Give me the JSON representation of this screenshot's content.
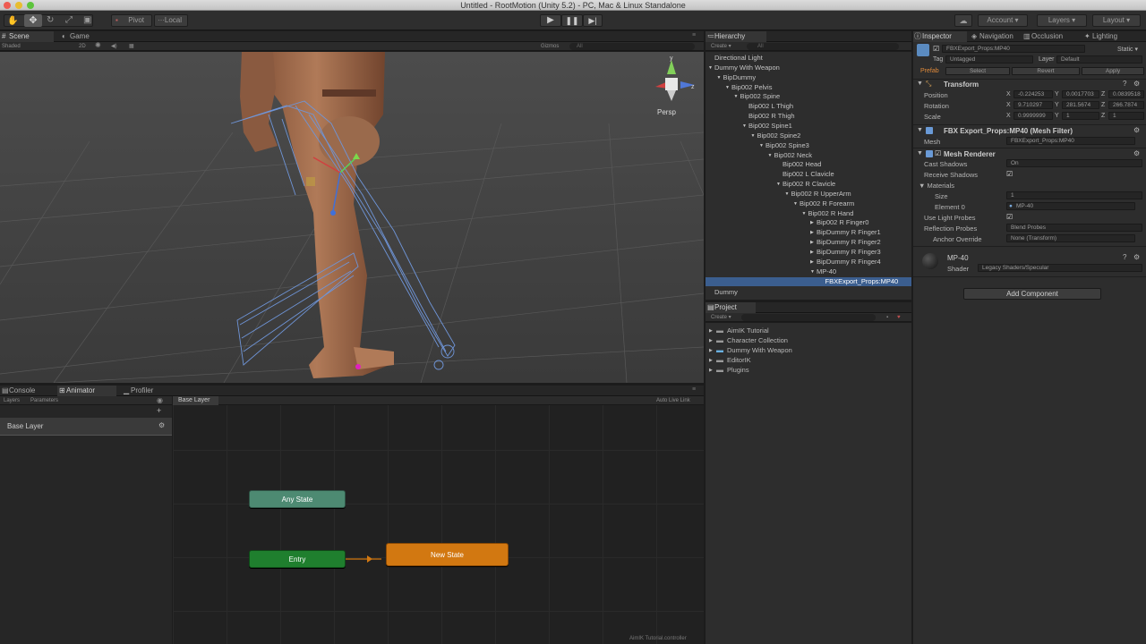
{
  "window": {
    "title": "Untitled - RootMotion (Unity 5.2) - PC, Mac & Linux Standalone"
  },
  "toolbar": {
    "pivot": "Pivot",
    "local": "Local",
    "account": "Account",
    "layers": "Layers",
    "layout": "Layout"
  },
  "scene": {
    "tabs": [
      "Scene",
      "Game"
    ],
    "shading": "Shaded",
    "mode_2d": "2D",
    "gizmos": "Gizmos",
    "search_placeholder": "All",
    "persp": "Persp"
  },
  "hierarchy": {
    "tab": "Hierarchy",
    "create": "Create",
    "search_placeholder": "All",
    "items": [
      {
        "label": "Directional Light",
        "depth": 0
      },
      {
        "label": "Dummy With Weapon",
        "depth": 0
      },
      {
        "label": "BipDummy",
        "depth": 1
      },
      {
        "label": "Bip002 Pelvis",
        "depth": 2
      },
      {
        "label": "Bip002 Spine",
        "depth": 3
      },
      {
        "label": "Bip002 L Thigh",
        "depth": 4
      },
      {
        "label": "Bip002 R Thigh",
        "depth": 4
      },
      {
        "label": "Bip002 Spine1",
        "depth": 4
      },
      {
        "label": "Bip002 Spine2",
        "depth": 5
      },
      {
        "label": "Bip002 Spine3",
        "depth": 6
      },
      {
        "label": "Bip002 Neck",
        "depth": 7
      },
      {
        "label": "Bip002 Head",
        "depth": 8
      },
      {
        "label": "Bip002 L Clavicle",
        "depth": 8
      },
      {
        "label": "Bip002 R Clavicle",
        "depth": 8
      },
      {
        "label": "Bip002 R UpperArm",
        "depth": 9
      },
      {
        "label": "Bip002 R Forearm",
        "depth": 10
      },
      {
        "label": "Bip002 R Hand",
        "depth": 11
      },
      {
        "label": "Bip002 R Finger0",
        "depth": 12
      },
      {
        "label": "BipDummy R Finger1",
        "depth": 12
      },
      {
        "label": "BipDummy R Finger2",
        "depth": 12
      },
      {
        "label": "BipDummy R Finger3",
        "depth": 12
      },
      {
        "label": "BipDummy R Finger4",
        "depth": 12
      },
      {
        "label": "MP-40",
        "depth": 12
      },
      {
        "label": "FBXExport_Props:MP40",
        "depth": 13,
        "selected": true
      },
      {
        "label": "Dummy",
        "depth": 0
      }
    ]
  },
  "project": {
    "tab": "Project",
    "create": "Create",
    "items": [
      "AimIK Tutorial",
      "Character Collection",
      "Dummy With Weapon",
      "EditorIK",
      "Plugins"
    ]
  },
  "inspector": {
    "tabs": [
      "Inspector",
      "Navigation",
      "Occlusion",
      "Lighting"
    ],
    "object_name": "FBXExport_Props:MP40",
    "static_label": "Static",
    "tag_label": "Tag",
    "tag_value": "Untagged",
    "layer_label": "Layer",
    "layer_value": "Default",
    "prefab_label": "Prefab",
    "prefab_buttons": [
      "Select",
      "Revert",
      "Apply"
    ],
    "transform": {
      "title": "Transform",
      "position_label": "Position",
      "position": {
        "x": "-0.224253",
        "y": "0.0017703",
        "z": "0.0839518"
      },
      "rotation_label": "Rotation",
      "rotation": {
        "x": "9.710297",
        "y": "281.5674",
        "z": "266.7874"
      },
      "scale_label": "Scale",
      "scale": {
        "x": "0.9999999",
        "y": "1",
        "z": "1"
      }
    },
    "mesh_filter": {
      "title": "FBX Export_Props:MP40 (Mesh Filter)",
      "mesh_label": "Mesh",
      "mesh_value": "FBXExport_Props:MP40"
    },
    "mesh_renderer": {
      "title": "Mesh Renderer",
      "cast_shadows_label": "Cast Shadows",
      "cast_shadows_value": "On",
      "receive_shadows_label": "Receive Shadows",
      "materials_label": "Materials",
      "size_label": "Size",
      "size_value": "1",
      "element0_label": "Element 0",
      "element0_value": "MP-40",
      "use_light_probes_label": "Use Light Probes",
      "reflection_probes_label": "Reflection Probes",
      "reflection_probes_value": "Blend Probes",
      "anchor_override_label": "Anchor Override",
      "anchor_override_value": "None (Transform)"
    },
    "material": {
      "name": "MP-40",
      "shader_label": "Shader",
      "shader_value": "Legacy Shaders/Specular"
    },
    "add_component": "Add Component"
  },
  "animator": {
    "tabs": [
      "Console",
      "Animator",
      "Profiler"
    ],
    "left_tabs": [
      "Layers",
      "Parameters"
    ],
    "layer": "Base Layer",
    "breadcrumb": "Base Layer",
    "auto_live_link": "Auto Live Link",
    "nodes": {
      "any_state": "Any State",
      "entry": "Entry",
      "new_state": "New State"
    },
    "footer": "AimIK Tutorial.controller"
  },
  "colors": {
    "any_state": "#4d8a72",
    "entry": "#1f7f2e",
    "new_state": "#d27811",
    "selection": "#3b5e8f"
  }
}
